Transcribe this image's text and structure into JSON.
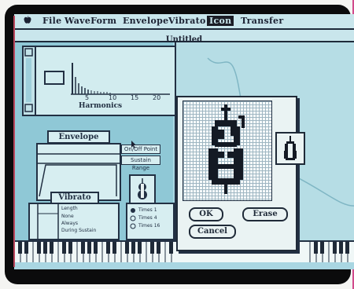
{
  "menubar": {
    "items": [
      {
        "name": "menu-file",
        "label": "File"
      },
      {
        "name": "menu-waveform",
        "label": "WaveForm"
      },
      {
        "name": "menu-envelope",
        "label": "Envelope"
      },
      {
        "name": "menu-vibrato",
        "label": "Vibrato"
      },
      {
        "name": "menu-icon",
        "label": "Icon"
      },
      {
        "name": "menu-transfer",
        "label": "Transfer"
      }
    ],
    "active": "Icon"
  },
  "window": {
    "title": "Untitled"
  },
  "harmonics": {
    "label": "Harmonics",
    "ticks": [
      "5",
      "10",
      "15",
      "20"
    ]
  },
  "envelope": {
    "label": "Envelope",
    "buttons": {
      "on_off_point": "On/Off Point",
      "sustain_range": "Sustain Range"
    }
  },
  "vibrato": {
    "label": "Vibrato",
    "length_label": "Length",
    "options_a": [
      "None",
      "Always",
      "During Sustain"
    ],
    "options_b": [
      "Times 1",
      "Times 4",
      "Times 16"
    ]
  },
  "dialog": {
    "ok_label": "OK",
    "erase_label": "Erase",
    "cancel_label": "Cancel"
  },
  "colors": {
    "screen": "#a9d6e2",
    "ink": "#1f2a38",
    "frame_accent": "#d14b8c"
  },
  "icons": [
    "apple-icon",
    "cello-icon",
    "cello-thumb-icon"
  ]
}
